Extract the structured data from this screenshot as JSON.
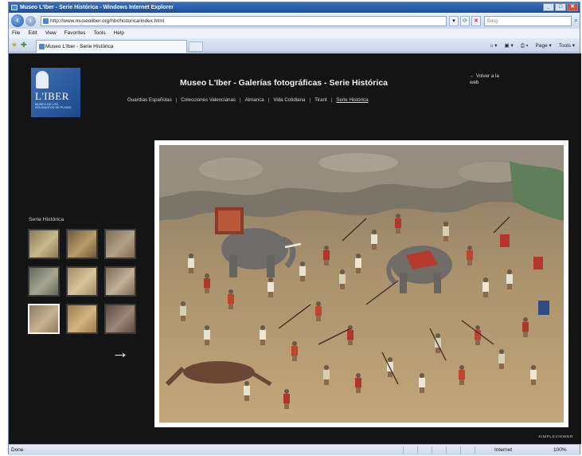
{
  "browser": {
    "title": "Museo L'Iber - Serie Histórica - Windows Internet Explorer",
    "url": "http://www.museoliber.org/hbr/historica/index.html",
    "search_placeholder": "Bing",
    "menu": [
      "File",
      "Edit",
      "View",
      "Favorites",
      "Tools",
      "Help"
    ],
    "tab_title": "Museo L'Iber - Serie Histórica",
    "command_items": [
      "Page ▾",
      "Tools ▾"
    ],
    "status": "Done",
    "zone": "Internet",
    "zoom": "100%"
  },
  "site": {
    "logo_text": "L'IBER",
    "logo_subtext": "MUSEO DE LOS SOLDADITOS DE PLOMO",
    "title": "Museo L'Iber - Galerías fotográficas - Serie Histórica",
    "nav": [
      {
        "label": "Guardias Españolas"
      },
      {
        "label": "Colecciones Valencianas"
      },
      {
        "label": "Almanca"
      },
      {
        "label": "Vida Cotidiana"
      },
      {
        "label": "Tirant"
      },
      {
        "label": "Serie Histórica",
        "active": true
      }
    ],
    "back_link": "← Volver a la web",
    "section_label": "Serie Histórica",
    "thumbnails": [
      {
        "color_a": "#8a7a52",
        "color_b": "#c9b98e",
        "selected": false
      },
      {
        "color_a": "#6e5a3c",
        "color_b": "#b79c6a",
        "selected": false
      },
      {
        "color_a": "#7d6b55",
        "color_b": "#b3a088",
        "selected": false
      },
      {
        "color_a": "#5f6a5c",
        "color_b": "#a8a58f",
        "selected": false
      },
      {
        "color_a": "#a08a64",
        "color_b": "#d8c49a",
        "selected": false
      },
      {
        "color_a": "#7a6a58",
        "color_b": "#c2b196",
        "selected": false
      },
      {
        "color_a": "#8c7a60",
        "color_b": "#c8b28e",
        "selected": true
      },
      {
        "color_a": "#9a7a48",
        "color_b": "#d4b582",
        "selected": false
      },
      {
        "color_a": "#5d4a42",
        "color_b": "#9d8677",
        "selected": false
      }
    ],
    "next_arrow": "→",
    "footer_brand": "SIMPLEVIEWER"
  },
  "colors": {
    "page_bg": "#141414",
    "chrome": "#d9e4f2",
    "title_bar": "#1d4d9a"
  }
}
